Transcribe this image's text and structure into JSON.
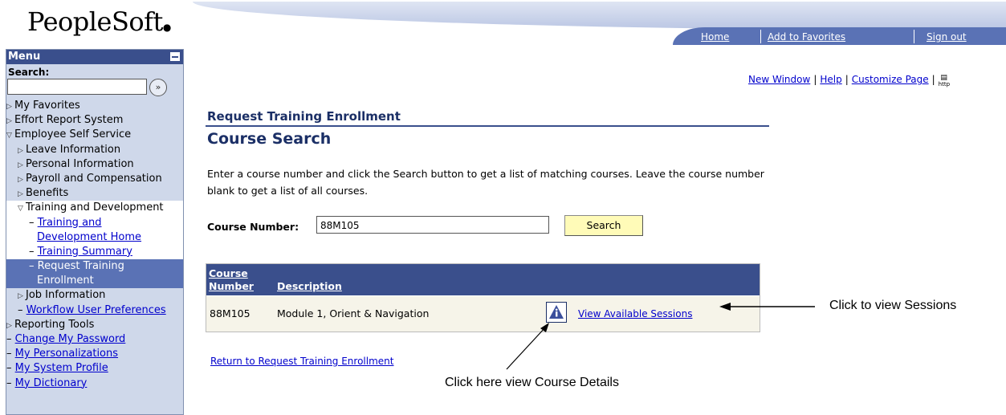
{
  "logo": {
    "text": "PeopleSoft"
  },
  "header": {
    "links": [
      "Home",
      "Add to Favorites",
      "Sign out"
    ]
  },
  "sidebar": {
    "menu_title": "Menu",
    "search_label": "Search:",
    "search_value": "",
    "items": [
      {
        "label": "My Favorites"
      },
      {
        "label": "Effort Report System"
      },
      {
        "label": "Employee Self Service"
      },
      {
        "label": "Leave Information"
      },
      {
        "label": "Personal Information"
      },
      {
        "label": "Payroll and Compensation"
      },
      {
        "label": "Benefits"
      },
      {
        "label": "Training and Development"
      },
      {
        "label": "Training and"
      },
      {
        "label": "Development Home"
      },
      {
        "label": "Training Summary"
      },
      {
        "label": "Request Training"
      },
      {
        "label": "Enrollment"
      },
      {
        "label": "Job Information"
      },
      {
        "label": "Workflow User Preferences"
      },
      {
        "label": "Reporting Tools"
      },
      {
        "label": "Change My Password"
      },
      {
        "label": "My Personalizations"
      },
      {
        "label": "My System Profile"
      },
      {
        "label": "My Dictionary"
      }
    ]
  },
  "pagelinks": {
    "new_window": "New Window",
    "help": "Help",
    "customize": "Customize Page",
    "http_icon_text": "http"
  },
  "main": {
    "breadcrumb": "Request Training Enrollment",
    "title": "Course Search",
    "instructions": "Enter a course number and click the Search button to get a list of matching courses.  Leave the course number blank to get a list of all courses.",
    "course_number_label": "Course Number:",
    "course_number_value": "88M105",
    "search_button": "Search",
    "grid": {
      "col1_line1": "Course",
      "col1_line2": "Number",
      "col2": "Description",
      "rows": [
        {
          "number": "88M105",
          "description": "Module 1, Orient & Navigation",
          "action": "View Available Sessions"
        }
      ]
    },
    "return_link": "Return to Request Training Enrollment"
  },
  "annotations": {
    "sessions": "Click to view Sessions",
    "details": "Click here view Course Details"
  },
  "colors": {
    "menu_header": "#3a4f8c",
    "grid_header": "#3a4f8c",
    "title": "#1b2f66",
    "link": "#0000cc"
  }
}
